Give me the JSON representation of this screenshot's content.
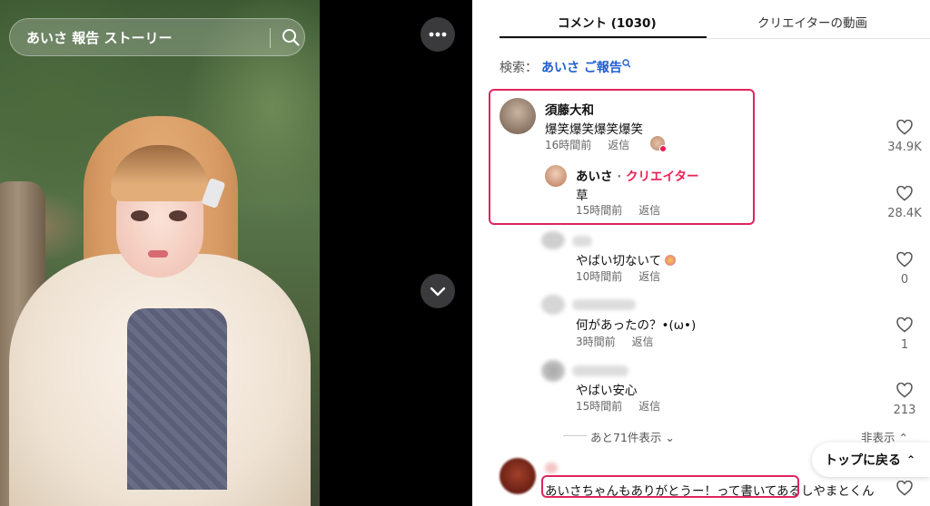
{
  "video": {
    "search_text": "あいさ 報告 ストーリー"
  },
  "tabs": [
    {
      "label": "コメント (1030)",
      "active": true
    },
    {
      "label": "クリエイターの動画",
      "active": false
    }
  ],
  "search": {
    "prefix": "検索：",
    "keyword": "あいさ ご報告"
  },
  "comments": [
    {
      "user": "須藤大和",
      "text": "爆笑爆笑爆笑爆笑",
      "time": "16時間前",
      "reply": "返信",
      "likes": "34.9K"
    },
    {
      "user": "あいさ",
      "separator": "·",
      "badge": "クリエイター",
      "text": "草",
      "time": "15時間前",
      "reply": "返信",
      "likes": "28.4K"
    },
    {
      "user": "",
      "text": "やばい切ないて",
      "time": "10時間前",
      "reply": "返信",
      "likes": "0"
    },
    {
      "user": "",
      "text": "何があったの？•(ω•)",
      "time": "3時間前",
      "reply": "返信",
      "likes": "1"
    },
    {
      "user": "",
      "text": "やばい安心",
      "time": "15時間前",
      "reply": "返信",
      "likes": "213"
    },
    {
      "user": "",
      "text_highlighted": "あいさちゃんもありがとうー！って書いてある",
      "text_rest": "しやまとくん",
      "likes": ""
    }
  ],
  "more": {
    "show_more": "あと71件表示",
    "hide": "非表示"
  },
  "to_top": "トップに戻る",
  "colors": {
    "accent_red": "#ee1d52",
    "highlight_box": "#e0245e",
    "link_blue": "#1f5fd1"
  }
}
